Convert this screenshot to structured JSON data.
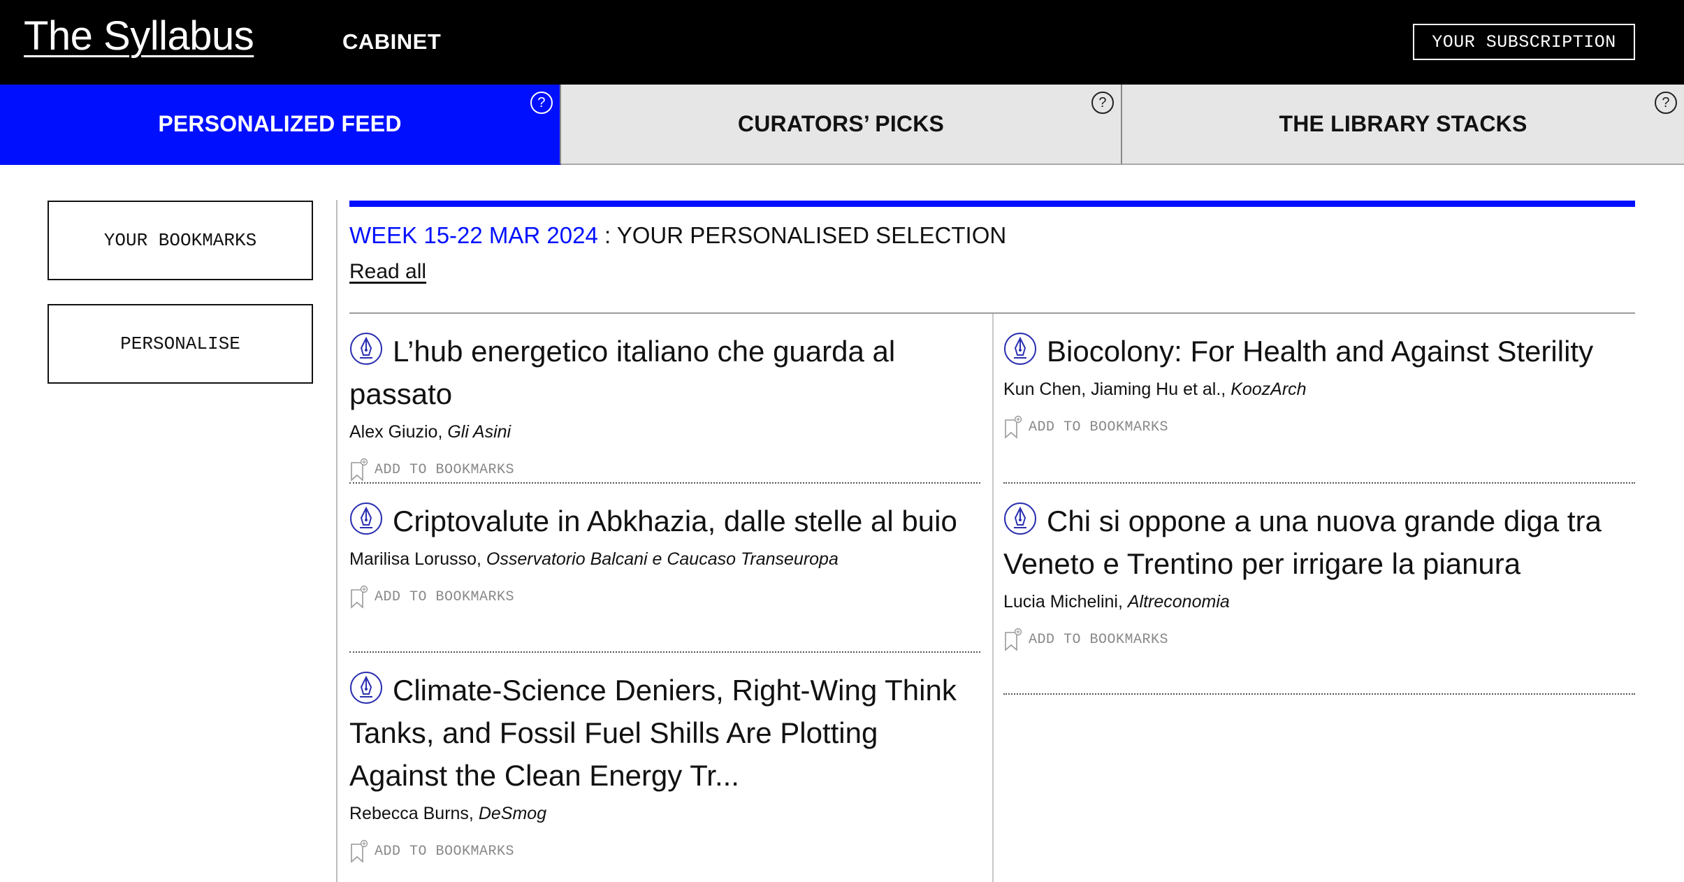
{
  "header": {
    "logo": "The Syllabus",
    "nav_cabinet": "CABINET",
    "subscription_label": "YOUR SUBSCRIPTION"
  },
  "tabs": [
    {
      "label": "PERSONALIZED FEED",
      "help": "?",
      "active": true
    },
    {
      "label": "CURATORS’ PICKS",
      "help": "?",
      "active": false
    },
    {
      "label": "THE LIBRARY STACKS",
      "help": "?",
      "active": false
    }
  ],
  "sidebar": {
    "bookmarks_label": "YOUR BOOKMARKS",
    "personalise_label": "PERSONALISE"
  },
  "feed": {
    "week": "WEEK 15-22 MAR 2024",
    "heading_rest": " : YOUR PERSONALISED SELECTION",
    "read_all": "Read all",
    "add_to_bookmarks": "ADD TO BOOKMARKS",
    "articles": [
      {
        "title": "L’hub energetico italiano che guarda al passato",
        "author": "Alex Giuzio,",
        "publication": "Gli Asini"
      },
      {
        "title": "Biocolony: For Health and Against Sterility",
        "author": "Kun Chen, Jiaming Hu et al.,",
        "publication": "KoozArch"
      },
      {
        "title": "Criptovalute in Abkhazia, dalle stelle al buio",
        "author": "Marilisa Lorusso,",
        "publication": "Osservatorio Balcani e Caucaso Transeuropa"
      },
      {
        "title": "Chi si oppone a una nuova grande diga tra Veneto e Trentino per irrigare la pianura",
        "author": "Lucia Michelini,",
        "publication": "Altreconomia"
      },
      {
        "title": "Climate-Science Deniers, Right-Wing Think Tanks, and Fossil Fuel Shills Are Plotting Against the Clean Energy Tr...",
        "author": "Rebecca Burns,",
        "publication": "DeSmog"
      }
    ]
  },
  "colors": {
    "accent_blue": "#0010ff",
    "topbar": "#000000",
    "tab_inactive": "#e6e6e6"
  },
  "icons": [
    "help-icon",
    "fountain-pen-icon",
    "bookmark-add-icon"
  ]
}
